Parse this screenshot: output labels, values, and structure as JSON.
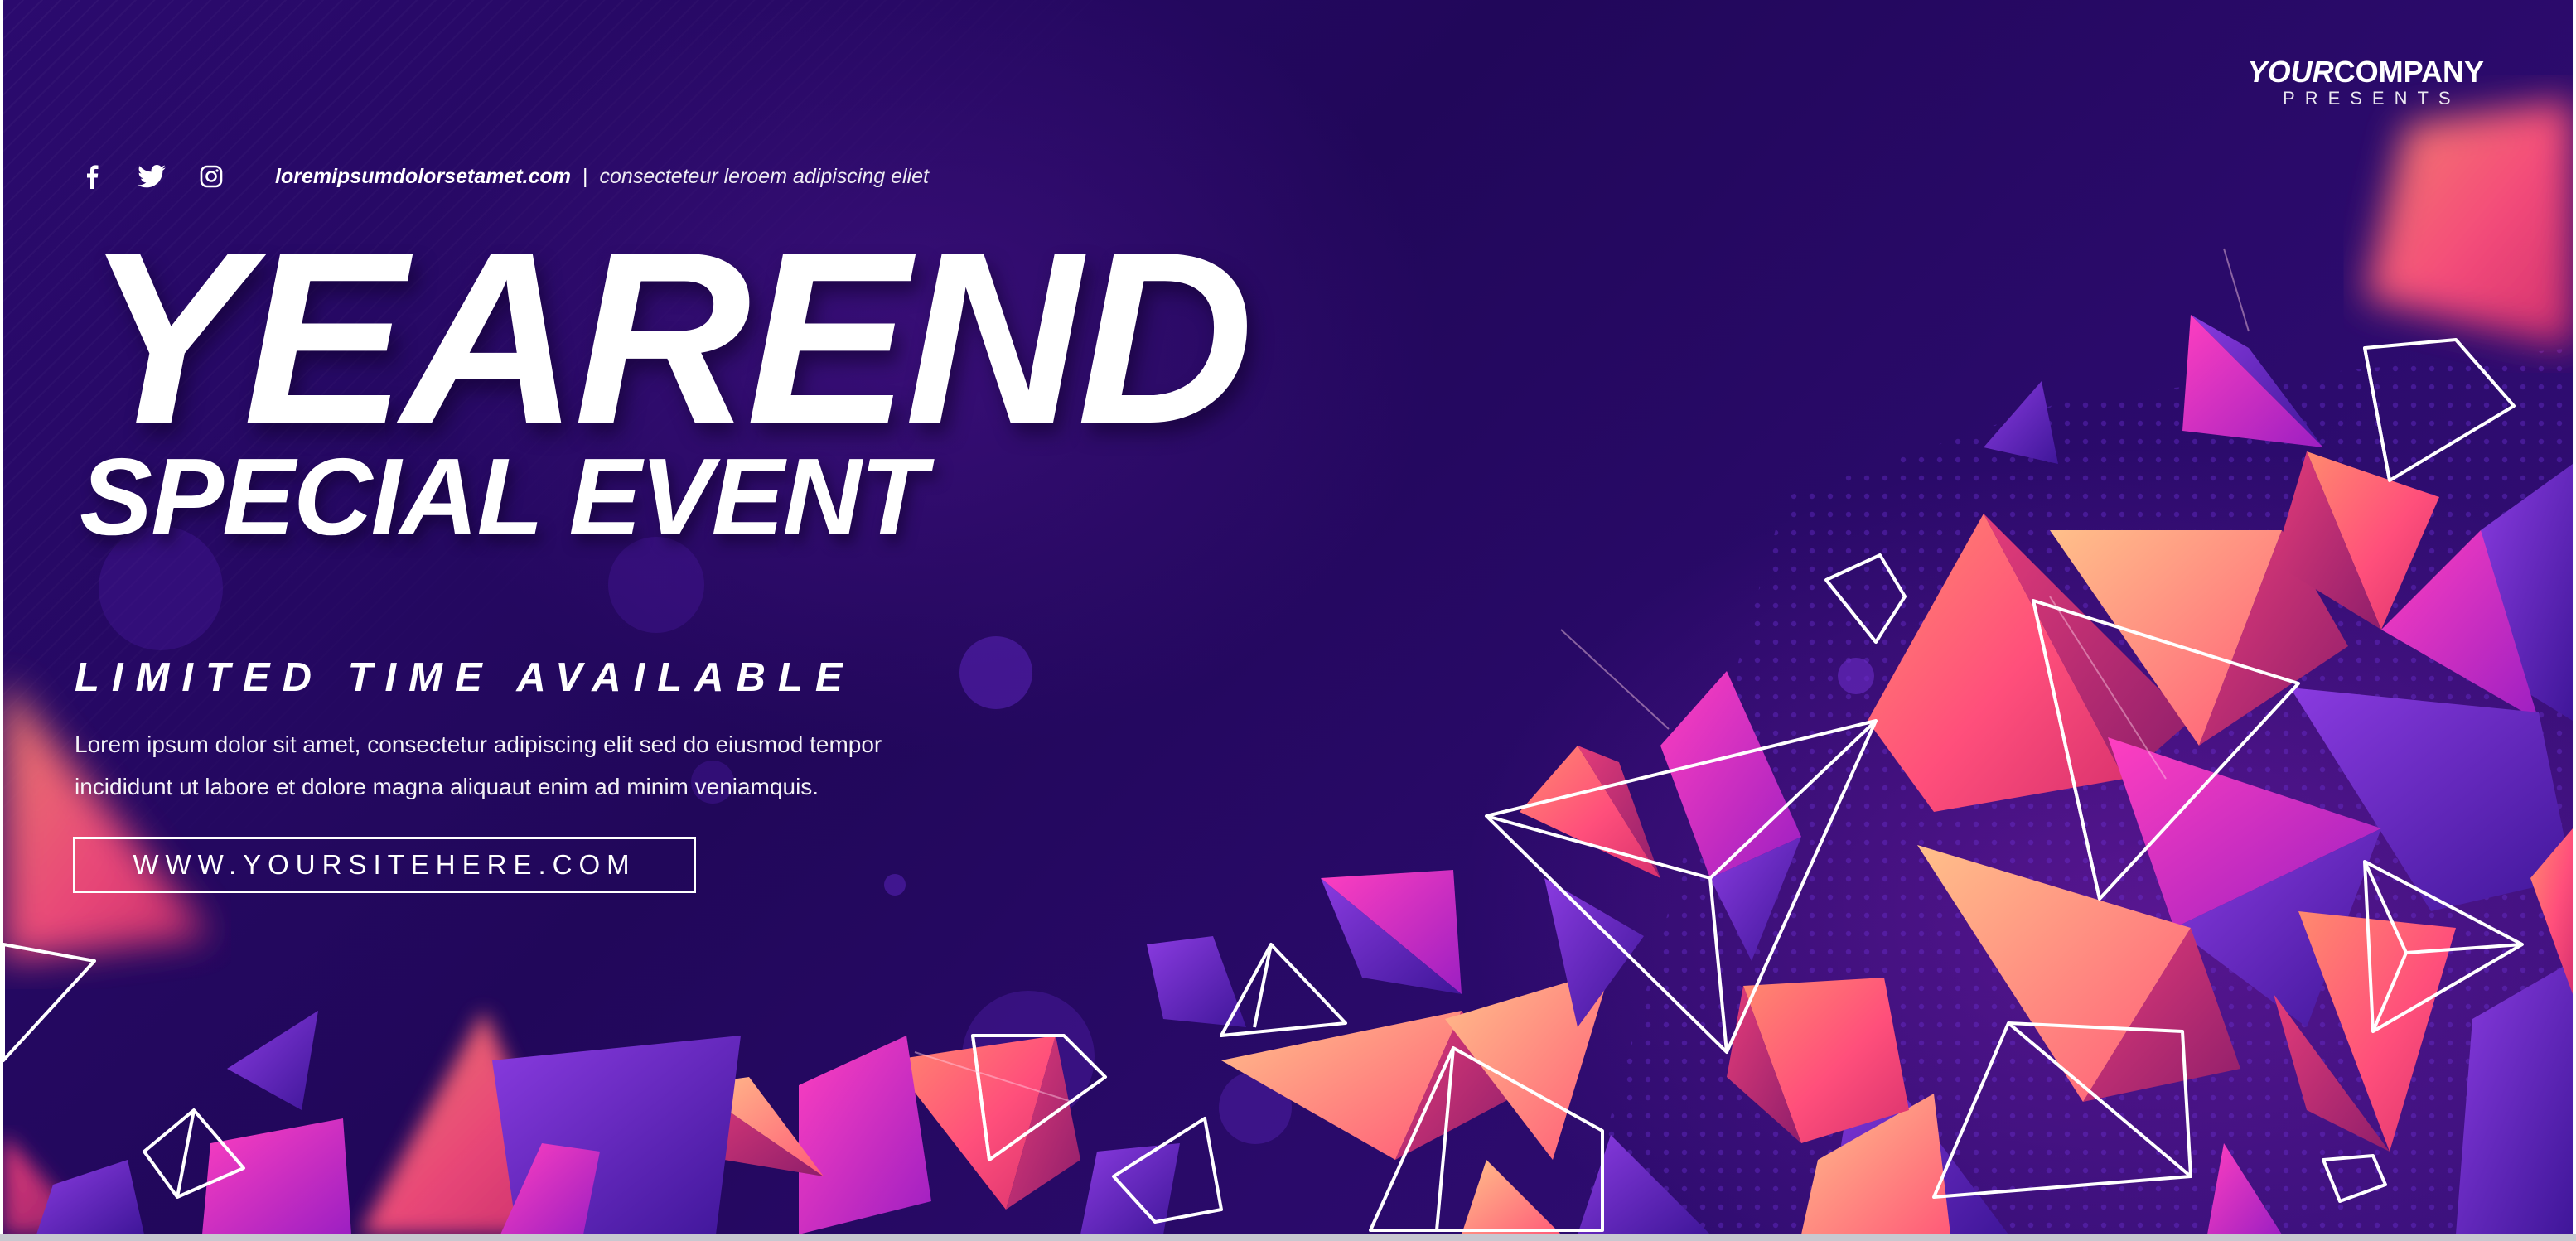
{
  "brand": {
    "name_italic": "YOUR",
    "name_bold": "COMPANY",
    "presents": "PRESENTS"
  },
  "social": {
    "icons": [
      "facebook-icon",
      "twitter-icon",
      "instagram-icon"
    ],
    "website": "loremipsumdolorsetamet.com",
    "separator": "|",
    "tagline": "consecteteur leroem adipiscing eliet"
  },
  "headline": {
    "title": "YEAREND",
    "subtitle": "SPECIAL EVENT"
  },
  "offer": {
    "label": "LIMITED TIME AVAILABLE",
    "body_line1": "Lorem ipsum dolor sit amet, consectetur adipiscing elit sed do eiusmod tempor",
    "body_line2": "incididunt ut labore et dolore magna aliquaut enim ad minim veniamquis."
  },
  "cta": {
    "label": "WWW.YOURSITEHERE.COM"
  },
  "colors": {
    "background": "#21075a",
    "accent_pink": "#ff4f7b",
    "accent_magenta": "#d72fd0",
    "accent_violet": "#6a2cc7",
    "text": "#ffffff"
  }
}
